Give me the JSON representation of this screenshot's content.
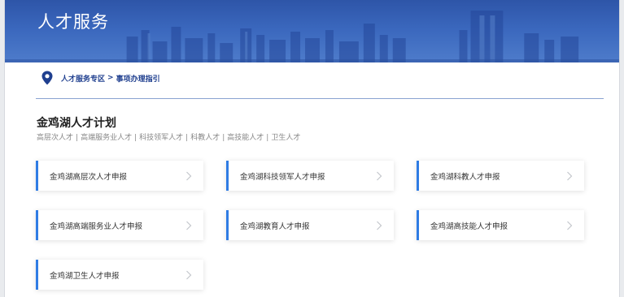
{
  "banner": {
    "title": "人才服务"
  },
  "breadcrumb": {
    "items": [
      "人才服务专区",
      "事项办理指引"
    ],
    "separator": ">"
  },
  "section": {
    "title": "金鸡湖人才计划",
    "categories": [
      "高层次人才",
      "高端服务业人才",
      "科技领军人才",
      "科教人才",
      "高技能人才",
      "卫生人才"
    ],
    "separator": "|"
  },
  "cards": [
    {
      "label": "金鸡湖高层次人才申报"
    },
    {
      "label": "金鸡湖科技领军人才申报"
    },
    {
      "label": "金鸡湖科教人才申报"
    },
    {
      "label": "金鸡湖高端服务业人才申报"
    },
    {
      "label": "金鸡湖教育人才申报"
    },
    {
      "label": "金鸡湖高技能人才申报"
    },
    {
      "label": "金鸡湖卫生人才申报"
    }
  ],
  "colors": {
    "banner": "#3a67bd",
    "accent": "#2f7ce4",
    "breadcrumb": "#1f3f8f"
  }
}
